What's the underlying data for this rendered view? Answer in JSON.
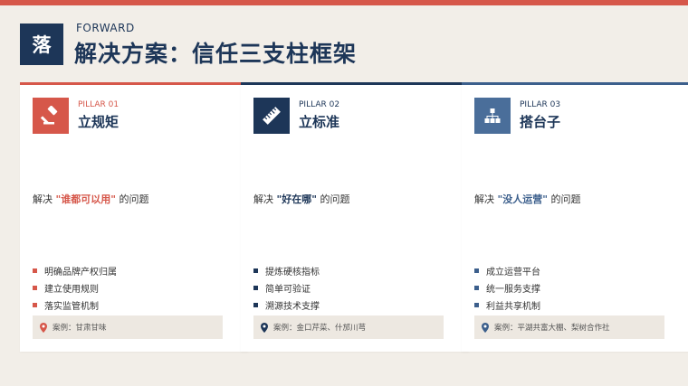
{
  "header": {
    "badge": "落",
    "subtitle": "FORWARD",
    "title": "解决方案：信任三支柱框架"
  },
  "pillars": [
    {
      "number": "PILLAR 01",
      "name": "立规矩",
      "icon": "gavel-icon",
      "solve_prefix": "解决 ",
      "solve_question": "\"谁都可以用\"",
      "solve_suffix": " 的问题",
      "bullets": [
        "明确品牌产权归属",
        "建立使用规则",
        "落实监管机制"
      ],
      "case": "案例：甘肃甘味",
      "accent": "#d6574a"
    },
    {
      "number": "PILLAR 02",
      "name": "立标准",
      "icon": "ruler-icon",
      "solve_prefix": "解决 ",
      "solve_question": "\"好在哪\"",
      "solve_suffix": " 的问题",
      "bullets": [
        "提炼硬核指标",
        "简单可验证",
        "溯源技术支撑"
      ],
      "case": "案例：金口芹菜、什邡川芎",
      "accent": "#1d3658"
    },
    {
      "number": "PILLAR 03",
      "name": "搭台子",
      "icon": "org-chart-icon",
      "solve_prefix": "解决 ",
      "solve_question": "\"没人运营\"",
      "solve_suffix": " 的问题",
      "bullets": [
        "成立运营平台",
        "统一服务支撑",
        "利益共享机制"
      ],
      "case": "案例：平湖共富大棚、梨树合作社",
      "accent": "#3c5f8c"
    }
  ]
}
